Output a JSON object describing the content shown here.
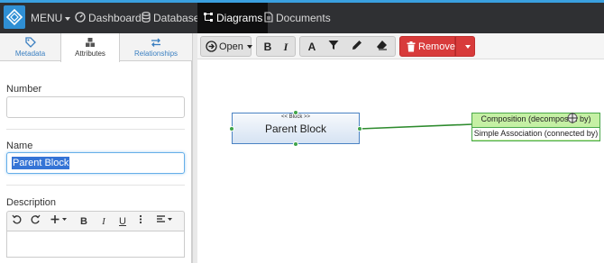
{
  "topnav": {
    "menu_label": "MENU",
    "items": [
      {
        "label": "Dashboard",
        "icon": "speedometer-icon"
      },
      {
        "label": "Database",
        "icon": "database-icon"
      },
      {
        "label": "Diagrams",
        "icon": "diagram-icon",
        "active": true
      },
      {
        "label": "Documents",
        "icon": "document-icon"
      }
    ],
    "accent_color": "#3aa0e0",
    "bg_color": "#2f3033"
  },
  "sidebar": {
    "tabs": [
      {
        "label": "Metadata",
        "icon": "tag-icon"
      },
      {
        "label": "Attributes",
        "icon": "cubes-icon",
        "active": true
      },
      {
        "label": "Relationships",
        "icon": "swap-arrows-icon"
      }
    ],
    "fields": {
      "number_label": "Number",
      "number_value": "",
      "name_label": "Name",
      "name_value": "Parent Block",
      "description_label": "Description"
    },
    "editor_tools": [
      "undo-icon",
      "redo-icon",
      "plus-icon",
      "B",
      "I",
      "U",
      "more-icon",
      "align-icon"
    ]
  },
  "toolbar": {
    "open_label": "Open",
    "bold_label": "B",
    "italic_label": "I",
    "font_label": "A",
    "remove_label": "Remove",
    "remove_color": "#d83b3b"
  },
  "diagram": {
    "block": {
      "stereotype": "<< Block >>",
      "name": "Parent Block"
    },
    "association": {
      "row1": "Composition (decomposed by)",
      "row2": "Simple Association (connected by)"
    },
    "connector_color": "#2e8b2e"
  }
}
